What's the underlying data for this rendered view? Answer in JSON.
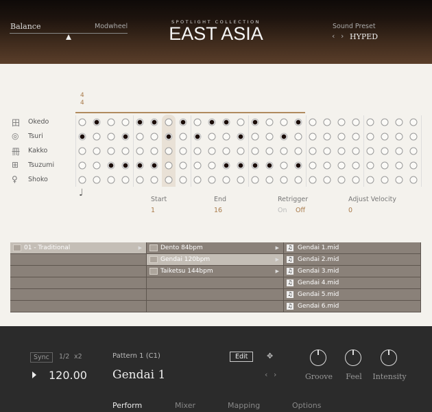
{
  "header": {
    "balance_label": "Balance",
    "modwheel_label": "Modwheel",
    "collection": "SPOTLIGHT COLLECTION",
    "title": "EAST ASIA",
    "preset_label": "Sound Preset",
    "preset_value": "HYPED",
    "balance_position": 0.46
  },
  "sequencer": {
    "time_sig_top": "4",
    "time_sig_bottom": "4",
    "steps": 24,
    "active_length": 16,
    "current_step": 7,
    "instruments": [
      {
        "name": "Okedo",
        "pattern": "010011010110100100000000"
      },
      {
        "name": "Tsuri",
        "pattern": "100100101001001000000000"
      },
      {
        "name": "Kakko",
        "pattern": "000000000000000000000000"
      },
      {
        "name": "Tsuzumi",
        "pattern": "001111000011110100000000"
      },
      {
        "name": "Shoko",
        "pattern": "000000000000000000000000"
      }
    ],
    "start_label": "Start",
    "start_value": "1",
    "end_label": "End",
    "end_value": "16",
    "retrigger_label": "Retrigger",
    "retrigger_on": "On",
    "retrigger_off": "Off",
    "velocity_label": "Adjust Velocity",
    "velocity_value": "0"
  },
  "browser": {
    "col1": [
      "01 - Traditional"
    ],
    "col2": [
      "Dento 84bpm",
      "Gendai 120bpm",
      "Taiketsu 144bpm"
    ],
    "col3": [
      "Gendai 1.mid",
      "Gendai 2.mid",
      "Gendai 3.mid",
      "Gendai 4.mid",
      "Gendai 5.mid",
      "Gendai 6.mid"
    ]
  },
  "transport": {
    "sync": "Sync",
    "half": "1/2",
    "double": "x2",
    "tempo": "120.00",
    "pattern_label": "Pattern 1 (C1)",
    "pattern_name": "Gendai 1",
    "edit": "Edit",
    "knobs": [
      "Groove",
      "Feel",
      "Intensity"
    ]
  },
  "tabs": [
    "Perform",
    "Mixer",
    "Mapping",
    "Options"
  ]
}
